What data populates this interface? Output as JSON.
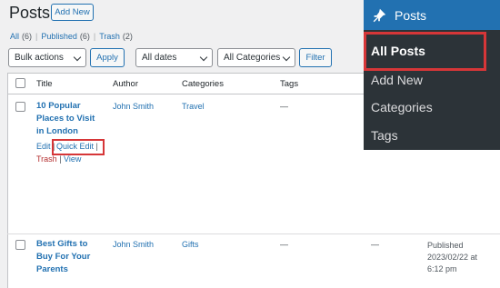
{
  "header": {
    "title": "Posts",
    "add_new": "Add New"
  },
  "filters": {
    "all": "All",
    "all_count": "(6)",
    "published": "Published",
    "published_count": "(6)",
    "trash": "Trash",
    "trash_count": "(2)",
    "sep": "|"
  },
  "bulk": {
    "select": "Bulk actions",
    "apply": "Apply"
  },
  "dates": {
    "select": "All dates"
  },
  "categories_filter": {
    "select": "All Categories",
    "filter": "Filter"
  },
  "table": {
    "headers": {
      "title": "Title",
      "author": "Author",
      "categories": "Categories",
      "tags": "Tags"
    },
    "rows": [
      {
        "title_lines": [
          "10 Popular",
          "Places to Visit",
          "in London"
        ],
        "author": "John Smith",
        "category": "Travel",
        "tags": "—",
        "actions": {
          "edit": "Edit",
          "sep": "|",
          "quick_edit": "Quick Edit",
          "trash": "Trash",
          "view": "View"
        }
      },
      {
        "title_lines": [
          "Best Gifts to",
          "Buy For Your",
          "Parents"
        ],
        "author": "John Smith",
        "category": "Gifts",
        "tags": "—",
        "comments": "—",
        "date_lines": [
          "Published",
          "2023/02/22 at",
          "6:12 pm"
        ]
      }
    ]
  },
  "admin_menu": {
    "icon": "pin-icon",
    "title": "Posts",
    "items": [
      "All Posts",
      "Add New",
      "Categories",
      "Tags"
    ]
  },
  "colors": {
    "accent": "#2271b1",
    "highlight": "#d63638",
    "menu_bg": "#2c3338"
  }
}
